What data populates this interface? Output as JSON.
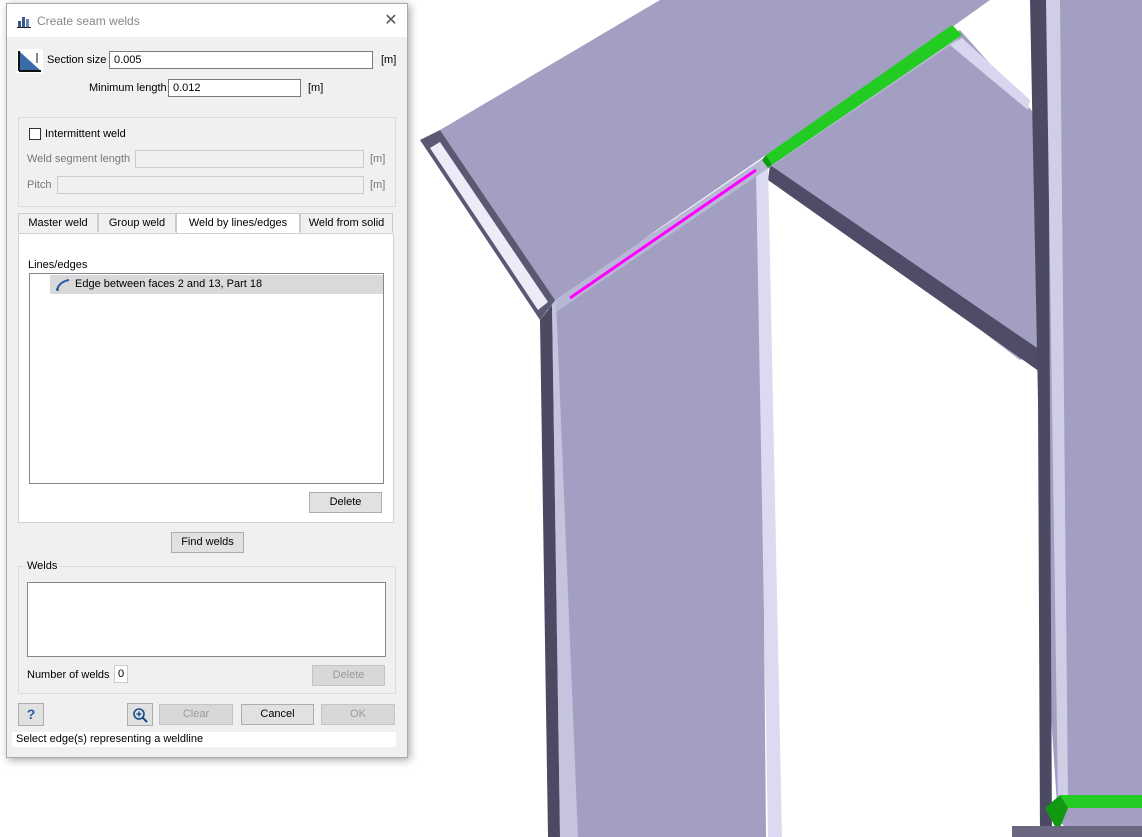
{
  "dialog": {
    "title": "Create seam welds",
    "close_symbol": "✕",
    "section_size": {
      "label": "Section size",
      "value": "0.005",
      "unit": "[m]"
    },
    "minimum_length": {
      "label": "Minimum length",
      "value": "0.012",
      "unit": "[m]"
    },
    "intermittent": {
      "checkbox_label": "Intermittent weld",
      "checked": false,
      "segment_length": {
        "label": "Weld segment length",
        "value": "",
        "unit": "[m]"
      },
      "pitch": {
        "label": "Pitch",
        "value": "",
        "unit": "[m]"
      }
    },
    "tabs": [
      {
        "label": "Master weld",
        "active": false
      },
      {
        "label": "Group weld",
        "active": false
      },
      {
        "label": "Weld by lines/edges",
        "active": true
      },
      {
        "label": "Weld from solid",
        "active": false
      }
    ],
    "lines_edges": {
      "label": "Lines/edges",
      "items": [
        "Edge between faces 2 and 13, Part 18"
      ],
      "delete_button": "Delete"
    },
    "find_welds_button": "Find welds",
    "welds": {
      "group_label": "Welds",
      "items": [],
      "count_label": "Number of welds",
      "count_value": "0",
      "delete_button": "Delete"
    },
    "footer": {
      "help_symbol": "?",
      "clear_button": "Clear",
      "cancel_button": "Cancel",
      "ok_button": "OK"
    },
    "status_text": "Select edge(s) representing a weldline"
  },
  "viewport": {
    "beam_color": "#a09dc0",
    "beam_shade_color": "#5a5873",
    "weld_green": "#22cc22",
    "selected_edge_magenta": "#ff00ff"
  }
}
